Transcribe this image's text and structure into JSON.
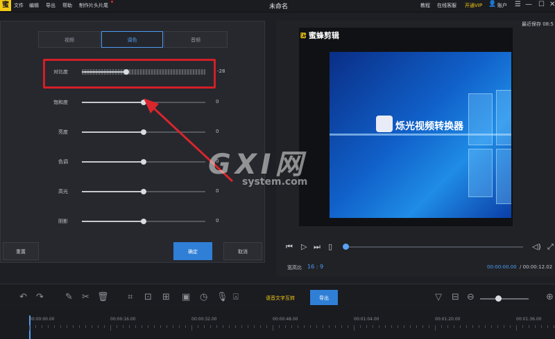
{
  "app": {
    "title": "未命名",
    "logo_text": "蜜"
  },
  "menu": [
    "文件",
    "编辑",
    "导出",
    "帮助",
    "制作片头片尾"
  ],
  "titlebar_right": {
    "tutorial": "教程",
    "online_service": "在线客服",
    "vip": "开通VIP",
    "account": "账户"
  },
  "window_controls": {
    "menu": "☰",
    "minimize": "—",
    "maximize": "☐",
    "close": "✕"
  },
  "tabs": [
    {
      "label": "视频",
      "active": false
    },
    {
      "label": "调色",
      "active": true
    },
    {
      "label": "音频",
      "active": false
    }
  ],
  "adjustments": [
    {
      "label": "对比度",
      "value": "-28",
      "level": 0.36,
      "highlighted": true
    },
    {
      "label": "饱和度",
      "value": "0",
      "level": 0.5
    },
    {
      "label": "亮度",
      "value": "0",
      "level": 0.5
    },
    {
      "label": "色调",
      "value": "0",
      "level": 0.5
    },
    {
      "label": "高光",
      "value": "0",
      "level": 0.5
    },
    {
      "label": "阴影",
      "value": "0",
      "level": 0.5
    }
  ],
  "buttons": {
    "reset": "重置",
    "confirm": "确定",
    "cancel": "取消"
  },
  "preview": {
    "brand": "蜜蜂剪辑",
    "product_title": "烁光视频转换器",
    "recent_save": "最近保存 08:5",
    "aspect_label": "宽高比",
    "aspect_value": "16 : 9",
    "current_time": "00:00:00.00",
    "total_time": "/ 00:00:12.02"
  },
  "toolbar": {
    "speech_to_text": "语音文字互转",
    "export": "导出"
  },
  "timeline": {
    "ticks": [
      "00:00:00.00",
      "00:00:16.00",
      "00:00:32.00",
      "00:00:48.00",
      "00:01:04.00",
      "00:01:20.00",
      "00:01:36.00"
    ]
  },
  "watermark": {
    "main": "GXI网",
    "sub": "system.com"
  },
  "colors": {
    "accent": "#2f7fd6",
    "vip": "#f3c915",
    "highlight": "#d21f26",
    "arrow": "#d9262c"
  }
}
